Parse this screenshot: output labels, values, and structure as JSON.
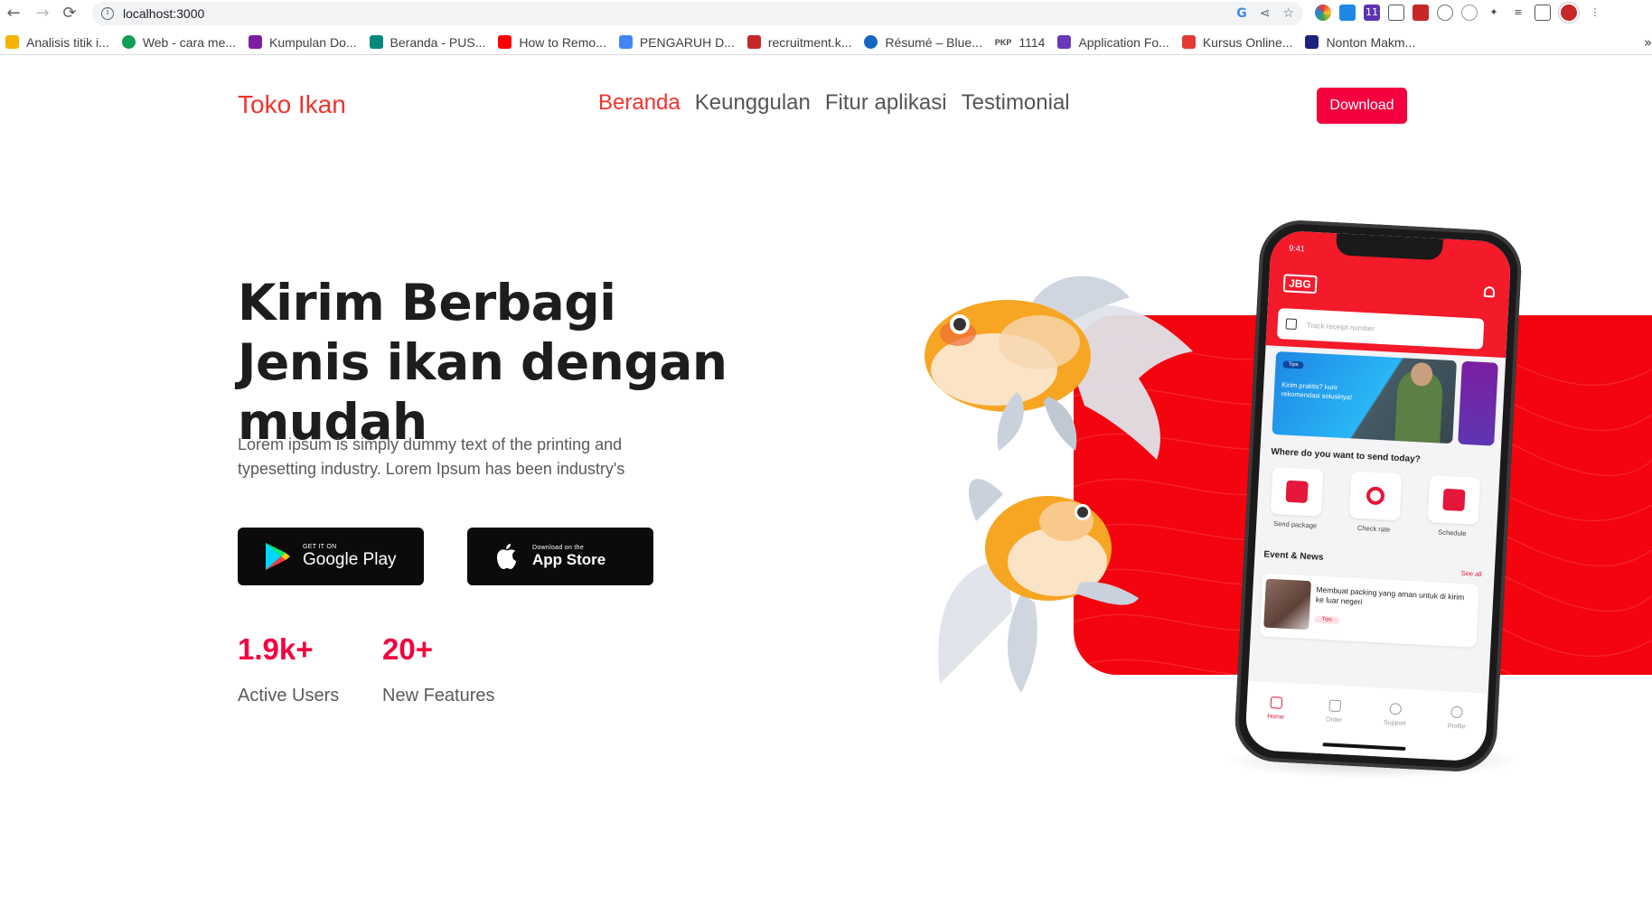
{
  "browser": {
    "url": "localhost:3000",
    "bookmarks": [
      {
        "label": "Analisis titik i...",
        "color": "#f4b400"
      },
      {
        "label": "Web - cara me...",
        "color": "#0f9d58"
      },
      {
        "label": "Kumpulan Do...",
        "color": "#7b1fa2"
      },
      {
        "label": "Beranda - PUS...",
        "color": "#00897b"
      },
      {
        "label": "How to Remo...",
        "color": "#ff0000"
      },
      {
        "label": "PENGARUH D...",
        "color": "#4285f4"
      },
      {
        "label": "recruitment.k...",
        "color": "#c62828"
      },
      {
        "label": "Résumé – Blue...",
        "color": "#1565c0"
      },
      {
        "label": "1114",
        "color": "#424242"
      },
      {
        "label": "Application Fo...",
        "color": "#673ab7"
      },
      {
        "label": "Kursus Online...",
        "color": "#e53935"
      },
      {
        "label": "Nonton Makm...",
        "color": "#1a237e"
      }
    ],
    "bookmark_prefix": "PKP"
  },
  "nav": {
    "brand": "Toko Ikan",
    "links": [
      "Beranda",
      "Keunggulan",
      "Fitur aplikasi",
      "Testimonial"
    ],
    "active_index": 0,
    "download_label": "Download"
  },
  "hero": {
    "title": "Kirim Berbagi Jenis ikan dengan mudah",
    "description": "Lorem ipsum is simply dummy text of the printing and typesetting industry. Lorem Ipsum has been industry's",
    "google_play": {
      "small": "GET IT ON",
      "big": "Google Play"
    },
    "app_store": {
      "small": "Download on the",
      "big": "App Store"
    }
  },
  "stats": [
    {
      "value": "1.9k+",
      "label": "Active Users"
    },
    {
      "value": "20+",
      "label": "New Features"
    }
  ],
  "phone": {
    "time": "9:41",
    "logo": "JBG",
    "search_placeholder": "Track receipt number",
    "banner_tag": "Tips",
    "banner_text": "Kirim praktis? kurir rekomendasi solusinya!",
    "question": "Where do you want to send today?",
    "actions": [
      "Send package",
      "Check rate",
      "Schedule"
    ],
    "events_title": "Event & News",
    "see_all": "See all",
    "news_text": "Membuat packing yang aman untuk di kirim ke luar negeri",
    "news_tag": "Tips",
    "tabs": [
      "Home",
      "Order",
      "Support",
      "Profile"
    ]
  },
  "colors": {
    "accent": "#f4003e",
    "brand": "#f1332e",
    "hero_block": "#f3040f"
  }
}
